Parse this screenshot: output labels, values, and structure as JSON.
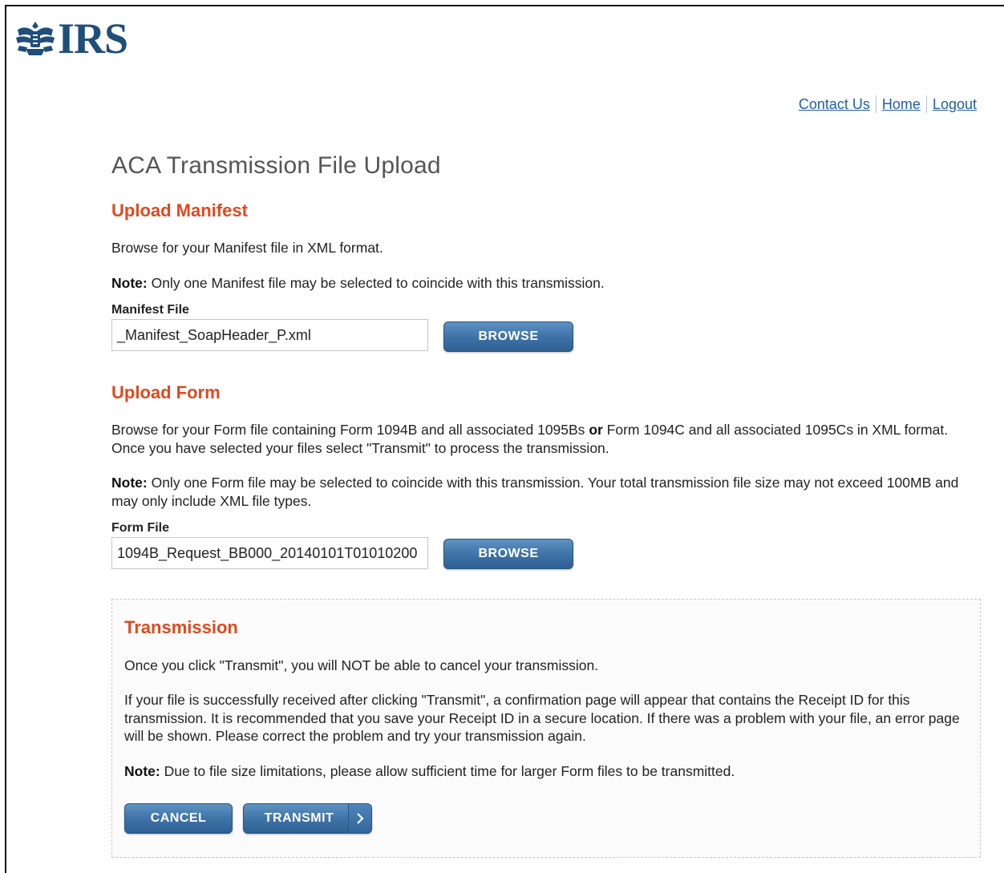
{
  "header": {
    "logo_text": "IRS",
    "links": [
      {
        "label": "Contact Us"
      },
      {
        "label": "Home"
      },
      {
        "label": "Logout"
      }
    ]
  },
  "page_title": "ACA Transmission File Upload",
  "manifest": {
    "heading": "Upload Manifest",
    "instructions": "Browse for your Manifest file in XML format.",
    "note_label": "Note:",
    "note_text": " Only one Manifest file may be selected to coincide with this transmission.",
    "field_label": "Manifest File",
    "field_value": "_Manifest_SoapHeader_P.xml",
    "browse_label": "BROWSE"
  },
  "form": {
    "heading": "Upload Form",
    "instructions_part1": "Browse for your Form file containing Form 1094B and all associated 1095Bs ",
    "instructions_or": "or",
    "instructions_part2": " Form 1094C and all associated 1095Cs in XML format. Once you have selected your files select \"Transmit\" to process the transmission.",
    "note_label": "Note:",
    "note_text": " Only one Form file may be selected to coincide with this transmission. Your total transmission file size may not exceed 100MB and may only include XML file types.",
    "field_label": "Form File",
    "field_value": "1094B_Request_BB000_20140101T01010200",
    "browse_label": "BROWSE"
  },
  "transmission": {
    "heading": "Transmission",
    "warning": "Once you click \"Transmit\", you will NOT be able to cancel your transmission.",
    "info": "If your file is successfully received after clicking \"Transmit\", a confirmation page will appear that contains the Receipt ID for this transmission. It is recommended that you save your Receipt ID in a secure location. If there was a problem with your file, an error page will be shown. Please correct the problem and try your transmission again.",
    "note_label": "Note:",
    "note_text": " Due to file size limitations, please allow sufficient time for larger Form files to be transmitted.",
    "cancel_label": "CANCEL",
    "transmit_label": "TRANSMIT"
  },
  "colors": {
    "heading_accent": "#e0491f",
    "link": "#1f5fa8",
    "button": "#3f74a8",
    "logo": "#1f4e79"
  }
}
